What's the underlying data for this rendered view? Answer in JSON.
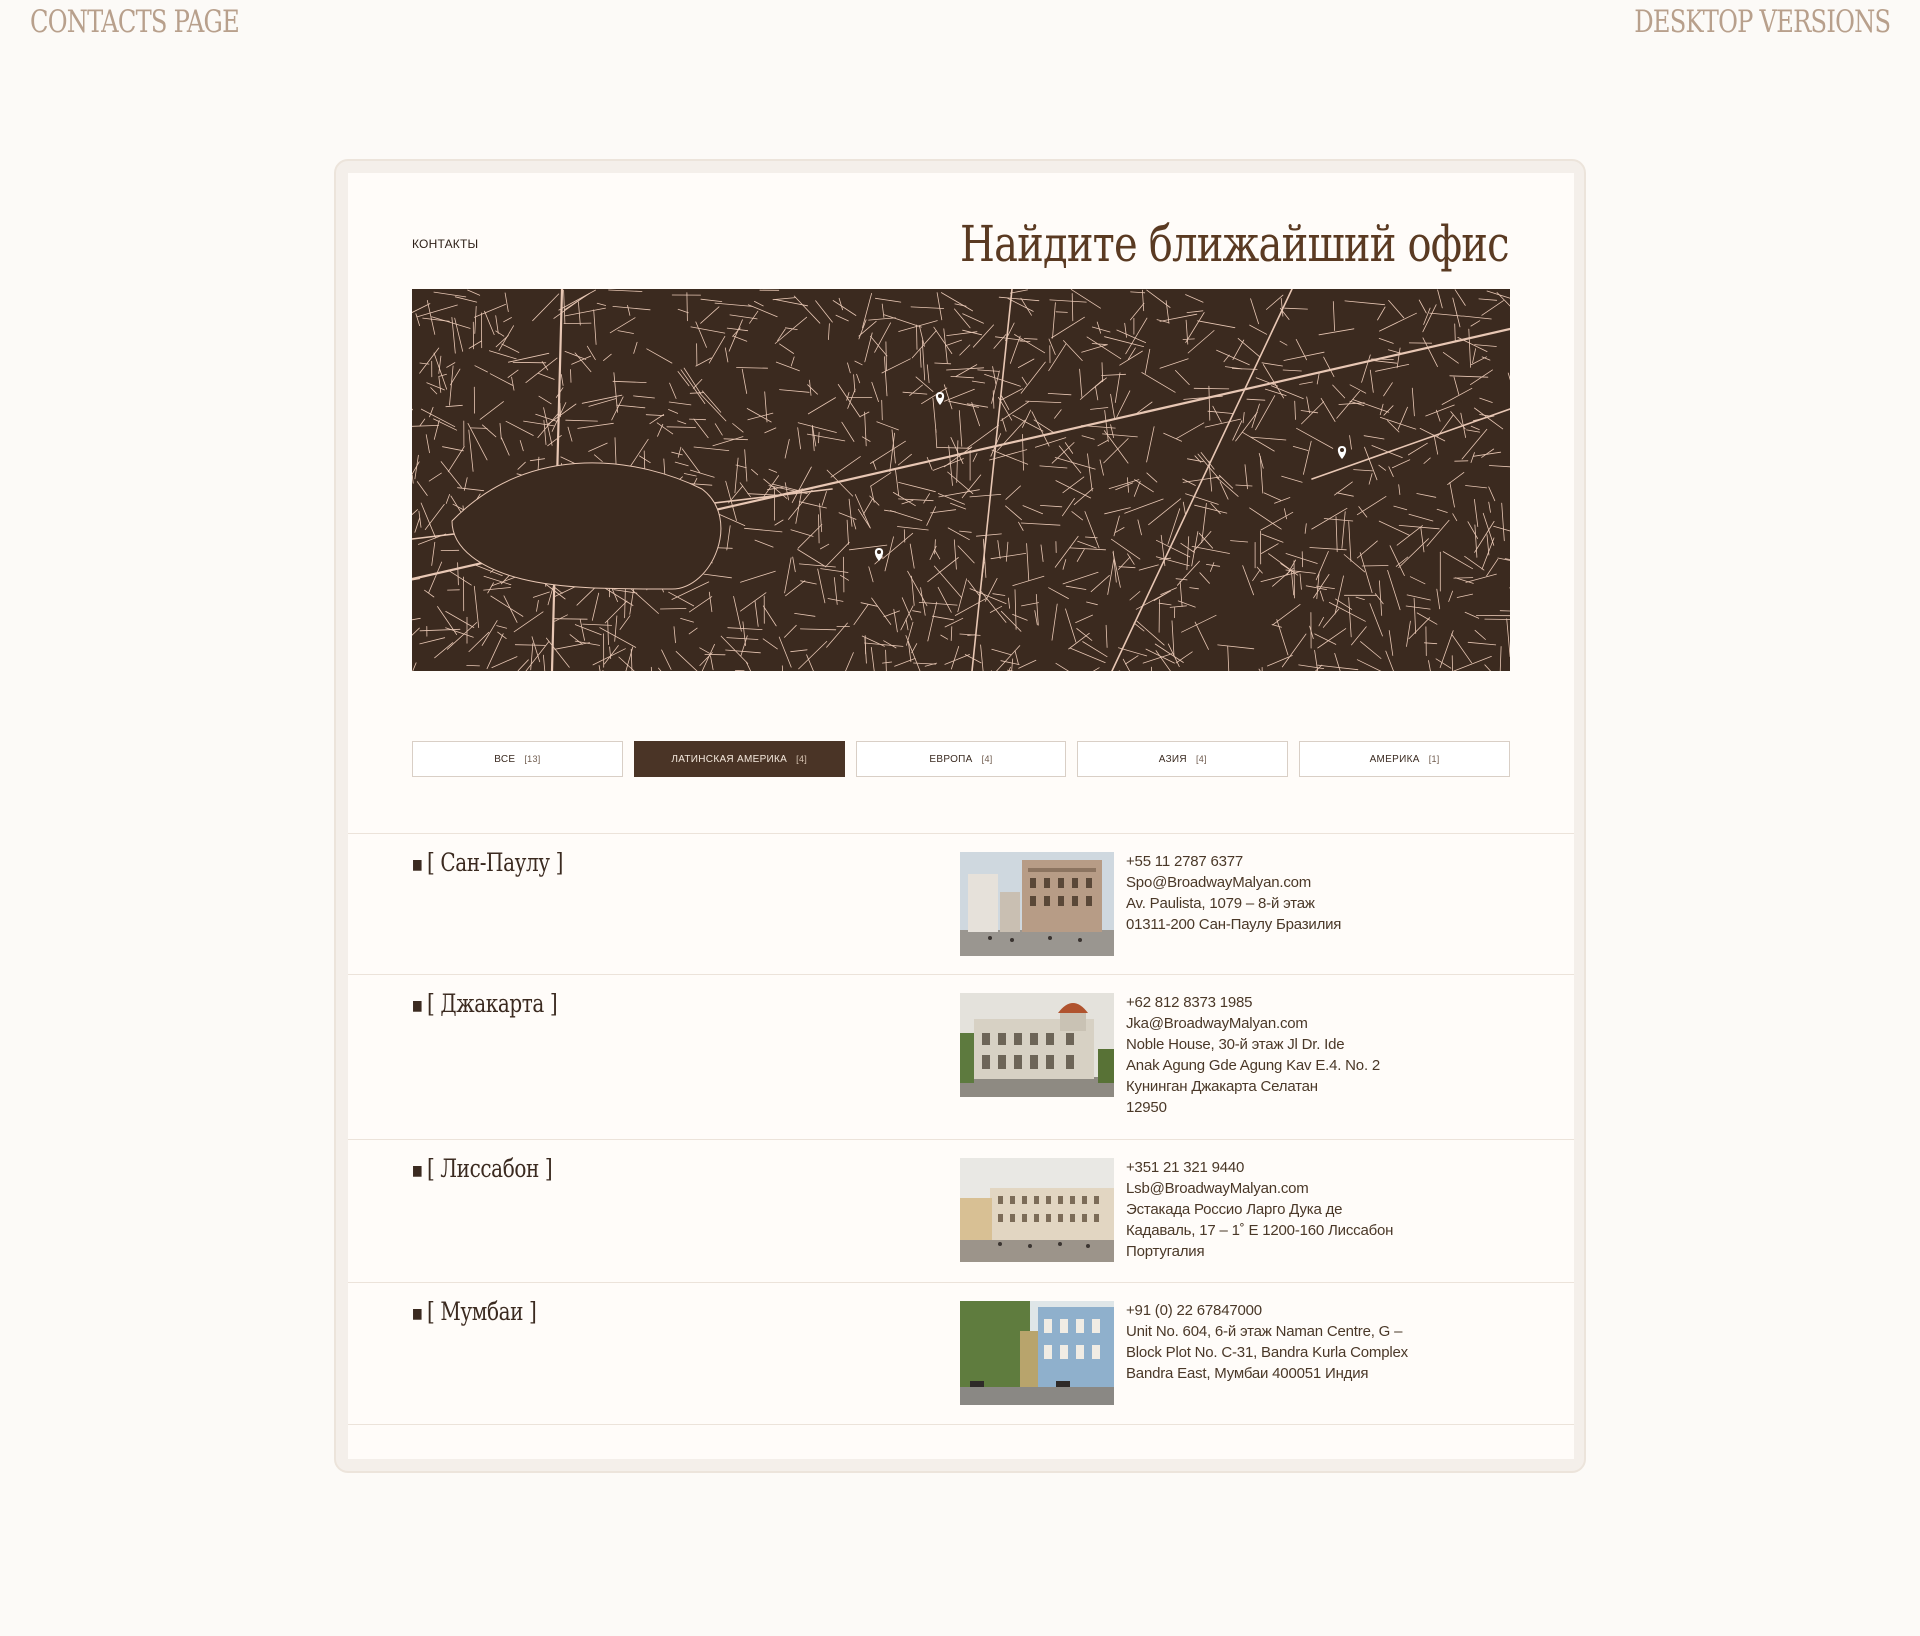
{
  "header": {
    "left_label": "CONTACTS PAGE",
    "right_label": "DESKTOP VERSIONS"
  },
  "page": {
    "breadcrumb": "КОНТАКТЫ",
    "title": "Найдите ближайший офис"
  },
  "map": {
    "background": "#3b2a1f",
    "road_color": "#e8c7b4",
    "pin_icon": "map-pin-icon",
    "pins_count_visible": 3
  },
  "filters": [
    {
      "label": "ВСЕ",
      "count": "[13]",
      "active": false
    },
    {
      "label": "ЛАТИНСКАЯ АМЕРИКА",
      "count": "[4]",
      "active": true
    },
    {
      "label": "ЕВРОПА",
      "count": "[4]",
      "active": false
    },
    {
      "label": "АЗИЯ",
      "count": "[4]",
      "active": false
    },
    {
      "label": "АМЕРИКА",
      "count": "[1]",
      "active": false
    }
  ],
  "offices": [
    {
      "name": "[ Сан-Паулу ]",
      "lines": [
        "+55 11 2787 6377",
        "Spo@BroadwayMalyan.com",
        "Av. Paulista, 1079 – 8-й этаж",
        "01311-200 Сан-Паулу Бразилия"
      ]
    },
    {
      "name": "[ Джакарта ]",
      "lines": [
        "+62 812 8373 1985",
        "Jka@BroadwayMalyan.com",
        "Noble House, 30-й этаж Jl Dr. Ide",
        "Anak Agung Gde Agung Kav E.4. No. 2",
        "Кунинган Джакарта Селатан",
        "12950"
      ]
    },
    {
      "name": "[ Лиссабон ]",
      "lines": [
        "+351 21 321 9440",
        "Lsb@BroadwayMalyan.com",
        "Эстакада Россио Ларго Дука де",
        "Кадаваль, 17 – 1˚ E 1200-160 Лиссабон",
        "Португалия"
      ]
    },
    {
      "name": "[ Мумбаи ]",
      "lines": [
        "+91 (0) 22 67847000",
        "Unit No. 604, 6-й этаж Naman Centre, G –",
        "Block Plot No. C-31, Bandra Kurla Complex",
        "Bandra East, Мумбаи 400051 Индия"
      ]
    }
  ],
  "colors": {
    "page_bg": "#fcfaf7",
    "accent": "#4a3426",
    "title": "#5a3a22"
  }
}
